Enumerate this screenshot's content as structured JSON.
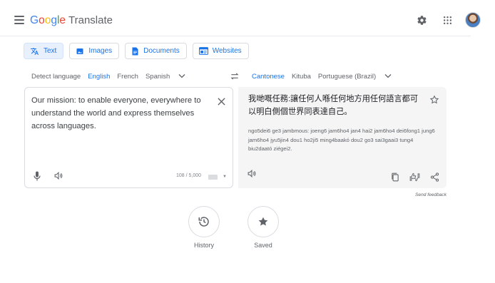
{
  "header": {
    "logo_letters": [
      "G",
      "o",
      "o",
      "g",
      "l",
      "e"
    ],
    "product": "Translate",
    "icons": [
      "menu-icon",
      "settings-icon",
      "apps-icon",
      "avatar"
    ]
  },
  "modes": [
    {
      "label": "Text",
      "icon": "translate-icon",
      "active": true
    },
    {
      "label": "Images",
      "icon": "image-icon",
      "active": false
    },
    {
      "label": "Documents",
      "icon": "document-icon",
      "active": false
    },
    {
      "label": "Websites",
      "icon": "website-icon",
      "active": false
    }
  ],
  "source_langs": [
    "Detect language",
    "English",
    "French",
    "Spanish"
  ],
  "source_active": "English",
  "target_langs": [
    "Cantonese",
    "Kituba",
    "Portuguese (Brazil)"
  ],
  "target_active": "Cantonese",
  "source": {
    "text": "Our mission: to enable everyone, everywhere to understand the world and express themselves across languages.",
    "counter": "108 / 5,000"
  },
  "target": {
    "text": "我哋嘅任務:讓任何人喺任何地方用任何語言都可以明白側個世界同表達自己。",
    "romanization": "ngo5dei6 ge3 jambmous: joeng6 jam6ho4 jan4 hai2 jam6ho4 dei6fong1 jung6 jam6ho4 jyu5jin4 dou1 ho2ji5 ming4baakó dou2 go3 sai3gaai3 tung4 biu2daató ziégei2."
  },
  "feedback": "Send feedback",
  "bottom": {
    "history": "History",
    "saved": "Saved"
  },
  "colors": {
    "accent": "#1a73e8",
    "active_bg": "#e8f0fe",
    "target_bg": "#f5f5f5"
  }
}
